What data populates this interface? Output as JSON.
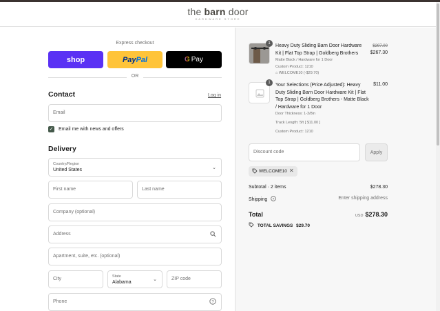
{
  "header": {
    "logo_light": "the",
    "logo_bold": "barn",
    "logo_end": "door",
    "logo_sub": "HARDWARE STORE"
  },
  "express": {
    "label": "Express checkout",
    "shop": "shop",
    "paypal_a": "Pay",
    "paypal_b": "Pal",
    "gpay_g": "G",
    "gpay_text": "Pay",
    "or": "OR"
  },
  "contact": {
    "title": "Contact",
    "login": "Log in",
    "email_placeholder": "Email",
    "news_label": "Email me with news and offers",
    "news_checked": true
  },
  "delivery": {
    "title": "Delivery",
    "country_label": "Country/Region",
    "country_value": "United States",
    "first_name": "First name",
    "last_name": "Last name",
    "company": "Company (optional)",
    "address": "Address",
    "apartment": "Apartment, suite, etc. (optional)",
    "city": "City",
    "state_label": "State",
    "state_value": "Alabama",
    "zip": "ZIP code",
    "phone": "Phone"
  },
  "summary": {
    "items": [
      {
        "qty": "1",
        "name_lines": [
          "Heavy Duty Sliding Barn Door Hardware",
          "Kit | Flat Top Strap | Goldberg Brothers"
        ],
        "variant": "Matte Black / Hardware for 1 Door",
        "custom": "Custom Product: 1210",
        "discount": "WELCOME10 (-$29.70)",
        "original_price": "$297.00",
        "price": "$267.30"
      },
      {
        "qty": "1",
        "name_lines": [
          "Your Selections (Price Adjusted): Heavy",
          "Duty Sliding Barn Door Hardware Kit | Flat",
          "Top Strap | Goldberg Brothers - Matte Black",
          "/ Hardware for 1 Door"
        ],
        "thickness": "Door Thickness: 1-3/8in",
        "track": "Track Length: 5ft [ $11.00 ]",
        "custom": "Custom Product: 1210",
        "price": "$11.00"
      }
    ],
    "discount_placeholder": "Discount code",
    "apply": "Apply",
    "code_tag": "WELCOME10",
    "subtotal_label": "Subtotal · 2 items",
    "subtotal_value": "$278.30",
    "shipping_label": "Shipping",
    "shipping_value": "Enter shipping address",
    "total_label": "Total",
    "currency": "USD",
    "total_value": "$278.30",
    "savings_label": "TOTAL SAVINGS",
    "savings_value": "$29.70"
  }
}
